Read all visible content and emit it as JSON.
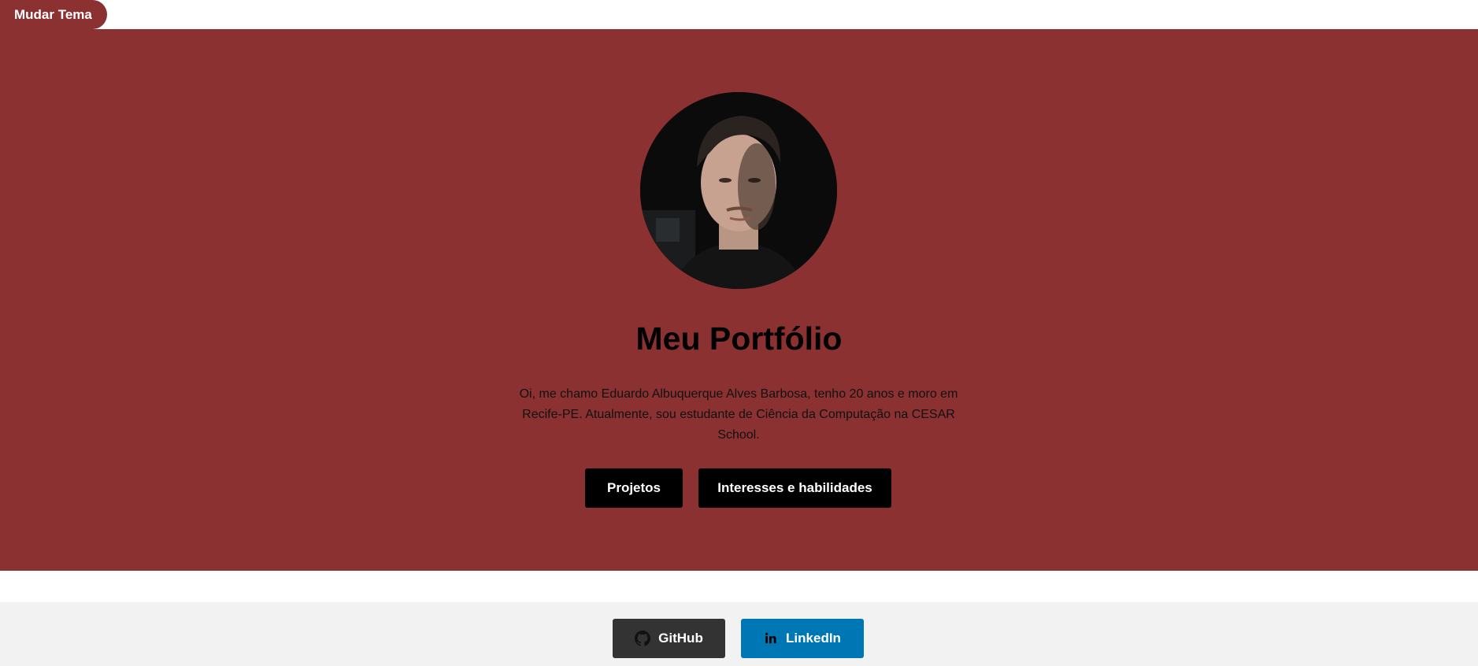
{
  "theme_button": {
    "label": "Mudar Tema"
  },
  "hero": {
    "title": "Meu Portfólio",
    "bio": "Oi, me chamo Eduardo Albuquerque Alves Barbosa, tenho 20 anos e moro em Recife-PE. Atualmente, sou estudante de Ciência da Computação na CESAR School.",
    "buttons": [
      {
        "label": "Projetos"
      },
      {
        "label": "Interesses e habilidades"
      }
    ]
  },
  "footer": {
    "links": [
      {
        "label": "GitHub",
        "icon": "github-icon"
      },
      {
        "label": "LinkedIn",
        "icon": "linkedin-icon"
      }
    ]
  },
  "colors": {
    "accent": "#8b3131",
    "button": "#000000",
    "github": "#333333",
    "linkedin": "#0077b5",
    "footer_bg": "#f2f2f2"
  }
}
